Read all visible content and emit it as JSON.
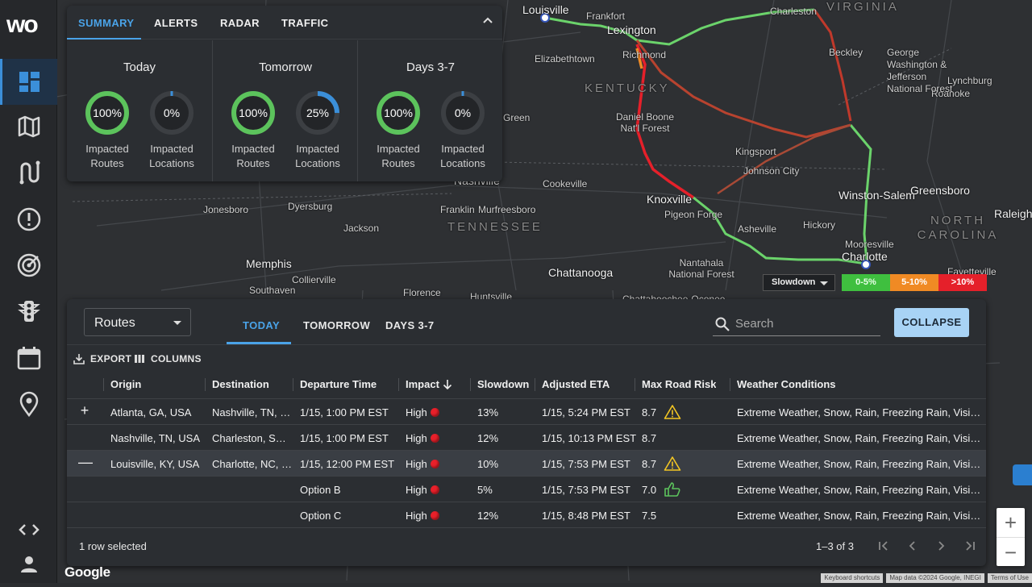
{
  "app": {
    "logo_text": "wo"
  },
  "sidebar": {
    "items": [
      {
        "name": "dashboard",
        "icon": "dashboard-icon",
        "active": true
      },
      {
        "name": "map",
        "icon": "map-icon"
      },
      {
        "name": "routes",
        "icon": "route-icon"
      },
      {
        "name": "alerts",
        "icon": "alert-icon"
      },
      {
        "name": "radar",
        "icon": "radar-icon"
      },
      {
        "name": "traffic",
        "icon": "traffic-light-icon"
      },
      {
        "name": "calendar",
        "icon": "calendar-icon"
      },
      {
        "name": "locations",
        "icon": "location-pin-icon"
      },
      {
        "name": "developer",
        "icon": "code-icon"
      },
      {
        "name": "account",
        "icon": "user-icon"
      }
    ]
  },
  "summary": {
    "tabs": [
      "SUMMARY",
      "ALERTS",
      "RADAR",
      "TRAFFIC"
    ],
    "active_tab": "SUMMARY",
    "columns": [
      {
        "title": "Today",
        "routes_value": "100%",
        "routes_pct": 100,
        "locations_value": "0%",
        "locations_pct": 0
      },
      {
        "title": "Tomorrow",
        "routes_value": "100%",
        "routes_pct": 100,
        "locations_value": "25%",
        "locations_pct": 25
      },
      {
        "title": "Days 3-7",
        "routes_value": "100%",
        "routes_pct": 100,
        "locations_value": "0%",
        "locations_pct": 0
      }
    ],
    "routes_label_1": "Impacted",
    "routes_label_2": "Routes",
    "locations_label_1": "Impacted",
    "locations_label_2": "Locations"
  },
  "legend": {
    "select_value": "Slowdown",
    "bins": [
      {
        "label": "0-5%",
        "color": "#3fbf3f"
      },
      {
        "label": "5-10%",
        "color": "#f08a24"
      },
      {
        "label": ">10%",
        "color": "#e5202a"
      }
    ]
  },
  "map": {
    "labels": [
      {
        "text": "Louisville",
        "kind": "big"
      },
      {
        "text": "Frankfort",
        "kind": "city"
      },
      {
        "text": "Lexington",
        "kind": "big"
      },
      {
        "text": "Charleston",
        "kind": "city"
      },
      {
        "text": "VIRGINIA",
        "kind": "state"
      },
      {
        "text": "Elizabethtown",
        "kind": "city"
      },
      {
        "text": "Richmond",
        "kind": "city"
      },
      {
        "text": "KENTUCKY",
        "kind": "state"
      },
      {
        "text": "Beckley",
        "kind": "city"
      },
      {
        "text": "Roanoke",
        "kind": "city"
      },
      {
        "text": "Lynchburg",
        "kind": "city"
      },
      {
        "text": "George Washington & Jefferson National Forest",
        "kind": "city"
      },
      {
        "text": "Daniel Boone Nat'l Forest",
        "kind": "city"
      },
      {
        "text": "Kingsport",
        "kind": "city"
      },
      {
        "text": "Johnson City",
        "kind": "city"
      },
      {
        "text": "Green",
        "kind": "city"
      },
      {
        "text": "Nashville",
        "kind": "big"
      },
      {
        "text": "Cookeville",
        "kind": "city"
      },
      {
        "text": "Knoxville",
        "kind": "big"
      },
      {
        "text": "Pigeon Forge",
        "kind": "city"
      },
      {
        "text": "Winston-Salem",
        "kind": "big"
      },
      {
        "text": "Greensboro",
        "kind": "big"
      },
      {
        "text": "Jonesboro",
        "kind": "city"
      },
      {
        "text": "Dyersburg",
        "kind": "city"
      },
      {
        "text": "Franklin",
        "kind": "city"
      },
      {
        "text": "Murfreesboro",
        "kind": "city"
      },
      {
        "text": "TENNESSEE",
        "kind": "state"
      },
      {
        "text": "NORTH CAROLINA",
        "kind": "state"
      },
      {
        "text": "Raleigh",
        "kind": "big"
      },
      {
        "text": "Asheville",
        "kind": "city"
      },
      {
        "text": "Hickory",
        "kind": "city"
      },
      {
        "text": "Mooresville",
        "kind": "city"
      },
      {
        "text": "Charlotte",
        "kind": "big"
      },
      {
        "text": "Fayetteville",
        "kind": "city"
      },
      {
        "text": "Jackson",
        "kind": "city"
      },
      {
        "text": "Memphis",
        "kind": "big"
      },
      {
        "text": "Collierville",
        "kind": "city"
      },
      {
        "text": "Southaven",
        "kind": "city"
      },
      {
        "text": "Chattanooga",
        "kind": "big"
      },
      {
        "text": "Nantahala National Forest",
        "kind": "city"
      },
      {
        "text": "Florence",
        "kind": "city"
      },
      {
        "text": "Huntsville",
        "kind": "city"
      },
      {
        "text": "Chattahoochee-Oconee",
        "kind": "city"
      }
    ]
  },
  "routes": {
    "view_select": "Routes",
    "tabs": [
      "TODAY",
      "TOMORROW",
      "DAYS 3-7"
    ],
    "active_tab": "TODAY",
    "search_placeholder": "Search",
    "collapse_label": "COLLAPSE",
    "export_label": "EXPORT",
    "columns_label": "COLUMNS",
    "headers": [
      "Origin",
      "Destination",
      "Departure Time",
      "Impact",
      "Slowdown",
      "Adjusted ETA",
      "Max Road Risk",
      "Weather Conditions"
    ],
    "rows": [
      {
        "expand": "+",
        "origin": "Atlanta, GA, USA",
        "destination": "Nashville, TN, USA",
        "departure": "1/15, 1:00 PM EST",
        "impact": "High",
        "slowdown": "13%",
        "eta": "1/15, 5:24 PM EST",
        "risk": "8.7",
        "risk_icon": "warning-icon",
        "weather": "Extreme Weather, Snow, Rain, Freezing Rain, Visibility",
        "selected": false
      },
      {
        "expand": "",
        "origin": "Nashville, TN, USA",
        "destination": "Charleston, SC, USA",
        "departure": "1/15, 1:00 PM EST",
        "impact": "High",
        "slowdown": "12%",
        "eta": "1/15, 10:13 PM EST",
        "risk": "8.7",
        "risk_icon": "",
        "weather": "Extreme Weather, Snow, Rain, Freezing Rain, Visibility",
        "selected": false
      },
      {
        "expand": "—",
        "origin": "Louisville, KY, USA",
        "destination": "Charlotte, NC, USA",
        "departure": "1/15, 12:00 PM EST",
        "impact": "High",
        "slowdown": "10%",
        "eta": "1/15, 7:53 PM EST",
        "risk": "8.7",
        "risk_icon": "warning-icon",
        "weather": "Extreme Weather, Snow, Rain, Freezing Rain, Visibility",
        "selected": true
      },
      {
        "expand": "",
        "origin": "",
        "destination": "",
        "departure": "Option B",
        "impact": "High",
        "slowdown": "5%",
        "eta": "1/15, 7:53 PM EST",
        "risk": "7.0",
        "risk_icon": "thumbs-up-icon",
        "weather": "Extreme Weather, Snow, Rain, Freezing Rain, Visibility",
        "selected": false
      },
      {
        "expand": "",
        "origin": "",
        "destination": "",
        "departure": "Option C",
        "impact": "High",
        "slowdown": "12%",
        "eta": "1/15, 8:48 PM EST",
        "risk": "7.5",
        "risk_icon": "",
        "weather": "Extreme Weather, Snow, Rain, Freezing Rain, Visibility",
        "selected": false
      }
    ],
    "selected_text": "1 row selected",
    "pager_text": "1–3 of 3"
  },
  "map_controls": {
    "zoom_in": "+",
    "zoom_out": "−",
    "google_text": "Google",
    "attribution": [
      "Keyboard shortcuts",
      "Map data ©2024 Google, INEGI",
      "Terms of Use"
    ]
  }
}
